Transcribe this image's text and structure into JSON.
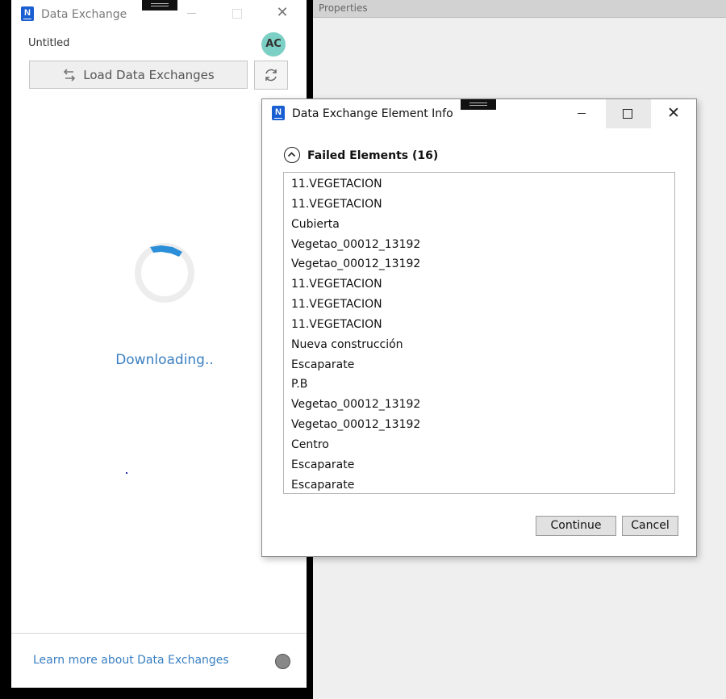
{
  "left_panel": {
    "title": "Data Exchange",
    "doc_name": "Untitled",
    "avatar_initials": "AC",
    "load_button_label": "Load Data Exchanges",
    "status_text": "Downloading..",
    "learn_more_link": "Learn more about Data Exchanges",
    "logo_letter": "N"
  },
  "properties": {
    "header": "Properties"
  },
  "dialog": {
    "title": "Data Exchange Element Info",
    "section_title": "Failed Elements (16)",
    "logo_letter": "N",
    "items": [
      "11.VEGETACION",
      "11.VEGETACION",
      "Cubierta",
      "Vegetao_00012_13192",
      "Vegetao_00012_13192",
      "11.VEGETACION",
      "11.VEGETACION",
      "11.VEGETACION",
      "Nueva construcción",
      "Escaparate",
      "P.B",
      "Vegetao_00012_13192",
      "Vegetao_00012_13192",
      "Centro",
      "Escaparate",
      "Escaparate"
    ],
    "continue_label": "Continue",
    "cancel_label": "Cancel",
    "close_glyph": "✕"
  },
  "colors": {
    "accent_blue": "#3a7fc1",
    "logo_blue": "#1a5fd1",
    "avatar_teal": "#7ccfc4",
    "spinner_blue": "#2a8fd8"
  }
}
